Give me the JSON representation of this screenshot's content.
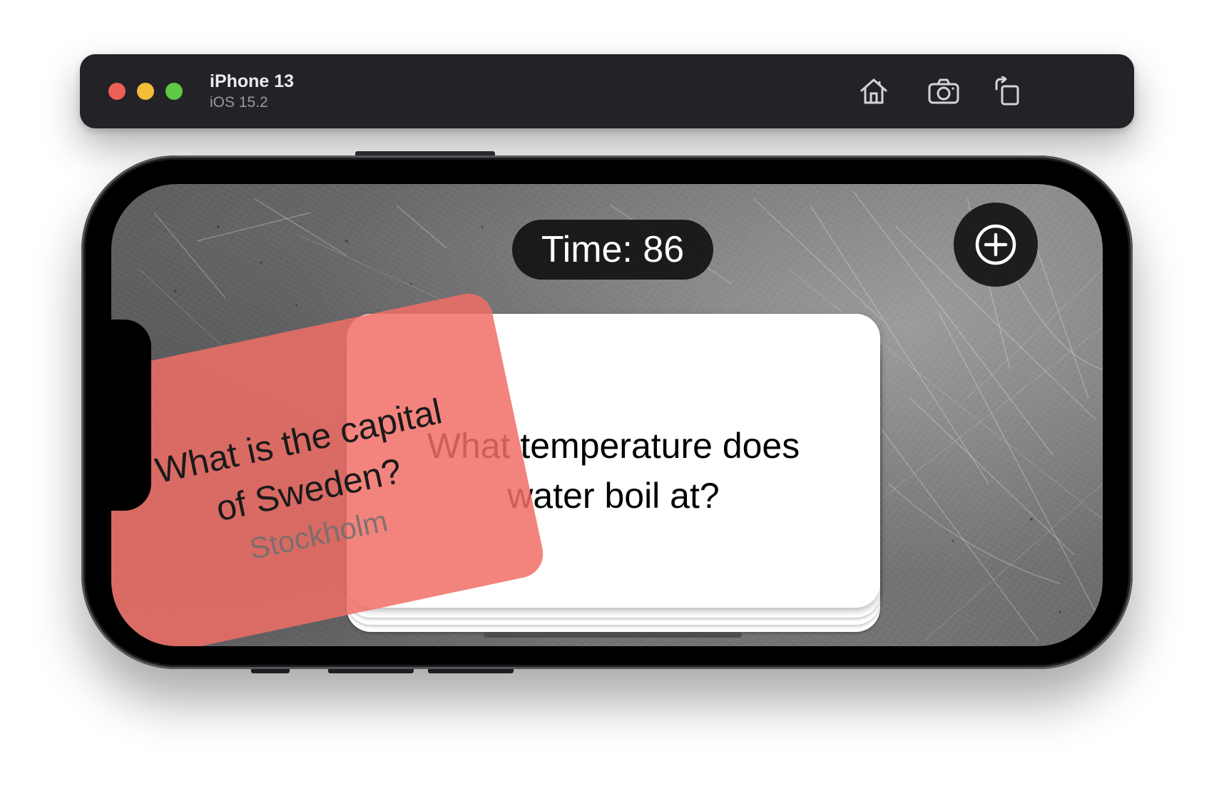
{
  "window": {
    "device_name": "iPhone 13",
    "os_version": "iOS 15.2",
    "toolbar": {
      "home": {
        "icon": "home-icon"
      },
      "screenshot": {
        "icon": "camera-icon"
      },
      "rotate": {
        "icon": "rotate-icon"
      }
    },
    "traffic_lights": {
      "close": "#ee5f57",
      "minimize": "#f1bc37",
      "zoom": "#5ec944"
    }
  },
  "app": {
    "timer": {
      "label": "Time:",
      "value": "86"
    },
    "add_button": {
      "icon": "plus-circle-icon"
    },
    "current_card": {
      "question_line1": "What temperature does",
      "question_line2": "water boil at?"
    },
    "dragged_card": {
      "question_line1": "What is the capital",
      "question_line2": "of Sweden?",
      "answer": "Stockholm",
      "color": "#f06e66"
    },
    "stacked_cards_below": 3
  }
}
